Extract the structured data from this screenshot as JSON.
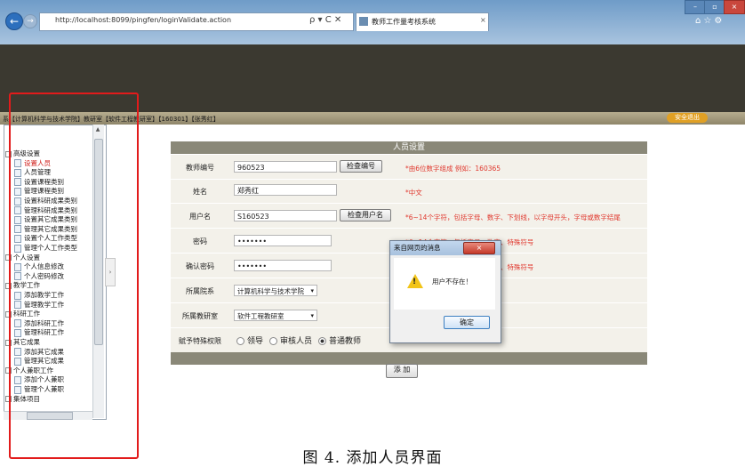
{
  "browser": {
    "address": "http://localhost:8099/pingfen/loginValidate.action",
    "address_icons": "ρ ▾ C ✕",
    "tab_title": "教师工作量考核系统",
    "tab_close": "×",
    "nav_back": "←",
    "nav_forward": "→",
    "win_min": "–",
    "win_max": "▫",
    "win_close": "×",
    "right_icons": "⌂☆⚙"
  },
  "header": {
    "user_info": "系【计算机科学与技术学院】教研室【软件工程教研室】【160301】【张秀红】",
    "logout_label": "安全退出"
  },
  "sidebar": {
    "scroll_up": "▲",
    "collapse_arrow": "›",
    "items": [
      {
        "label": "高级设置",
        "level": "parent"
      },
      {
        "label": "设置人员",
        "level": "child",
        "active": true
      },
      {
        "label": "人员管理",
        "level": "child"
      },
      {
        "label": "设置课程类别",
        "level": "child"
      },
      {
        "label": "管理课程类别",
        "level": "child"
      },
      {
        "label": "设置科研成果类别",
        "level": "child"
      },
      {
        "label": "管理科研成果类别",
        "level": "child"
      },
      {
        "label": "设置其它成果类别",
        "level": "child"
      },
      {
        "label": "管理其它成果类别",
        "level": "child"
      },
      {
        "label": "设置个人工作类型",
        "level": "child"
      },
      {
        "label": "管理个人工作类型",
        "level": "child"
      },
      {
        "label": "个人设置",
        "level": "parent"
      },
      {
        "label": "个人信息修改",
        "level": "child"
      },
      {
        "label": "个人密码修改",
        "level": "child"
      },
      {
        "label": "教学工作",
        "level": "parent"
      },
      {
        "label": "添加教学工作",
        "level": "child"
      },
      {
        "label": "管理教学工作",
        "level": "child"
      },
      {
        "label": "科研工作",
        "level": "parent"
      },
      {
        "label": "添加科研工作",
        "level": "child"
      },
      {
        "label": "管理科研工作",
        "level": "child"
      },
      {
        "label": "其它成果",
        "level": "parent"
      },
      {
        "label": "添加其它成果",
        "level": "child"
      },
      {
        "label": "管理其它成果",
        "level": "child"
      },
      {
        "label": "个人兼职工作",
        "level": "parent"
      },
      {
        "label": "添加个人兼职",
        "level": "child"
      },
      {
        "label": "管理个人兼职",
        "level": "child"
      },
      {
        "label": "集体项目",
        "level": "parent"
      }
    ]
  },
  "form": {
    "title": "人员设置",
    "teacher_id": {
      "label": "教师编号",
      "value": "960523",
      "button": "检查编号",
      "hint": "*由6位数字组成 例如：160365"
    },
    "name": {
      "label": "姓名",
      "value": "郑秀红",
      "hint": "*中文"
    },
    "username": {
      "label": "用户名",
      "value": "S160523",
      "button": "检查用户名",
      "hint": "*6~14个字符，包括字母、数字、下划线，以字母开头，字母或数字结尾"
    },
    "password": {
      "label": "密码",
      "value": "•••••••",
      "hint": "*6~14个字符，包括字母、数字、特殊符号"
    },
    "confirm_password": {
      "label": "确认密码",
      "value": "•••••••",
      "hint": "*6~14个字符，包括字母、数字、特殊符号"
    },
    "department": {
      "label": "所属院系",
      "value": "计算机科学与技术学院",
      "arrow": "▾"
    },
    "office": {
      "label": "所属教研室",
      "value": "软件工程教研室",
      "arrow": "▾"
    },
    "permission": {
      "label": "赋予特殊权限",
      "options": [
        "领导",
        "审核人员",
        "普通教师"
      ],
      "selected": "普通教师"
    },
    "submit_label": "添 加"
  },
  "dialog": {
    "title": "来自网页的消息",
    "close": "×",
    "icon_mark": "!",
    "message": "用户不存在！",
    "ok_label": "确定"
  },
  "caption": "图 4. 添加人员界面"
}
